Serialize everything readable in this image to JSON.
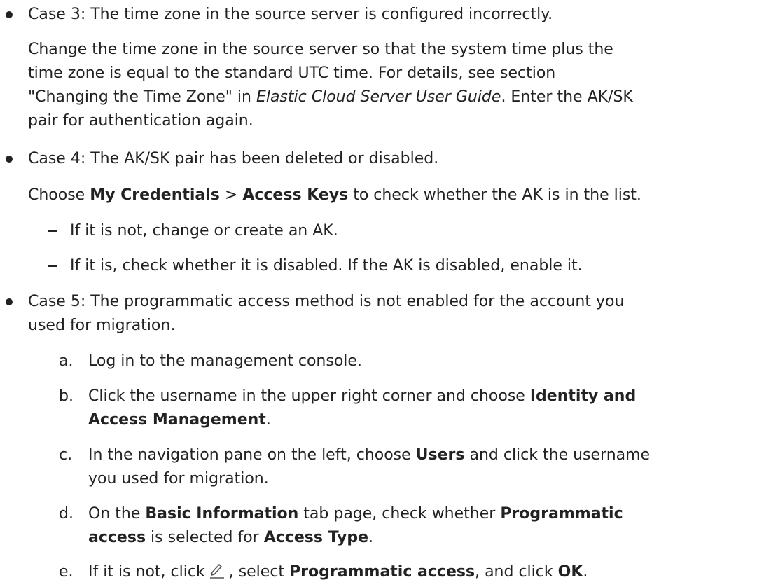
{
  "case3": {
    "title": "Case 3: The time zone in the source server is configured incorrectly.",
    "p1": "Change the time zone in the source server so that the system time plus the",
    "p2": "time zone is equal to the standard UTC time. For details, see section",
    "p3a": "\"Changing the Time Zone\" in ",
    "p3_guide": "Elastic Cloud Server User Guide",
    "p3b": ". Enter the AK/SK",
    "p4": "pair for authentication again."
  },
  "case4": {
    "title": "Case 4: The AK/SK pair has been deleted or disabled.",
    "choose": "Choose ",
    "my_credentials": "My Credentials",
    "gt": " > ",
    "access_keys": "Access Keys",
    "rest": " to check whether the AK is in the list.",
    "sub1": "If it is not, change or create an AK.",
    "sub2": "If it is, check whether it is disabled. If the AK is disabled, enable it."
  },
  "case5": {
    "title_line1": "Case 5: The programmatic access method is not enabled for the account you",
    "title_line2": "used for migration.",
    "a_marker": "a.",
    "a_text": "Log in to the management console.",
    "b_marker": "b.",
    "b_text1": "Click the username in the upper right corner and choose ",
    "b_bold1": "Identity and",
    "b_bold2": "Access Management",
    "b_end": ".",
    "c_marker": "c.",
    "c_text1": "In the navigation pane on the left, choose ",
    "c_bold": "Users",
    "c_text2": " and click the username",
    "c_text3": "you used for migration.",
    "d_marker": "d.",
    "d_text1": "On the ",
    "d_bold1": "Basic Information",
    "d_text2": " tab page, check whether ",
    "d_bold2": "Programmatic",
    "d_bold3": "access",
    "d_text3": " is selected for ",
    "d_bold4": "Access Type",
    "d_end": ".",
    "e_marker": "e.",
    "e_text1": "If it is not, click",
    "e_text2": ", select ",
    "e_bold1": "Programmatic access",
    "e_text3": ", and click ",
    "e_bold2": "OK",
    "e_end": ".",
    "icon": "edit-icon"
  }
}
